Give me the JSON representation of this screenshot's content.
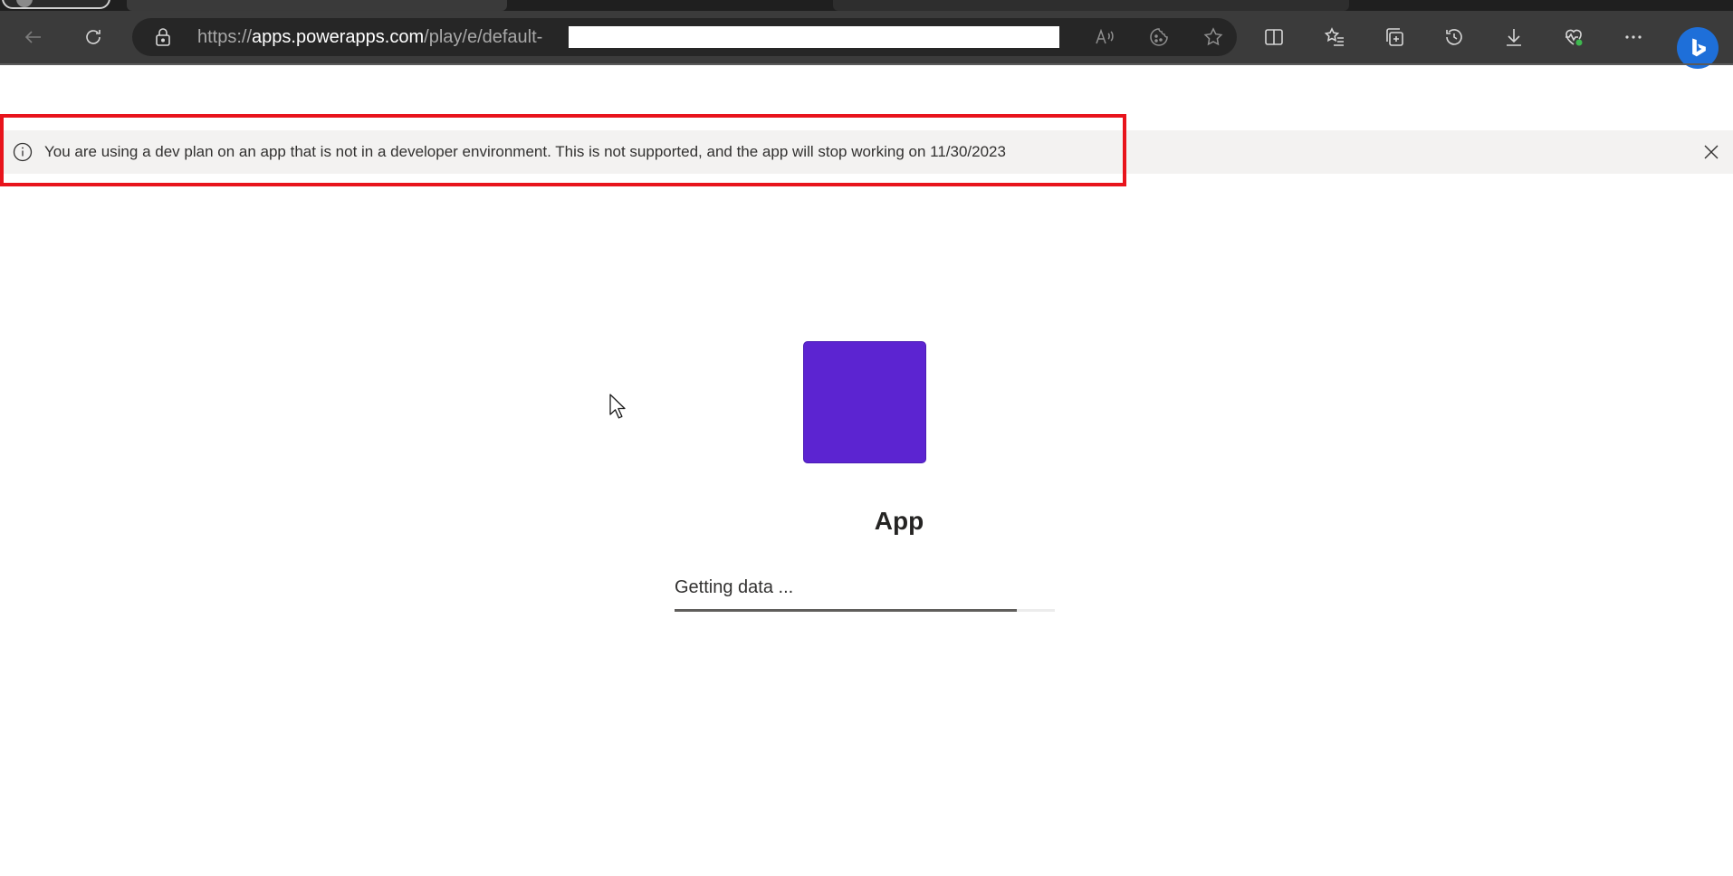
{
  "browser": {
    "url": {
      "scheme": "https://",
      "domain": "apps.powerapps.com",
      "path": "/play/e/default-"
    }
  },
  "banner": {
    "message": "You are using a dev plan on an app that is not in a developer environment. This is not supported, and the app will stop working on 11/30/2023"
  },
  "loading": {
    "app_name": "App",
    "app_tile_color": "#5c24d1",
    "status": "Getting data ...",
    "progress_percent": 90
  },
  "colors": {
    "highlight_border": "#e8141c",
    "banner_bg": "#f3f2f1",
    "toolbar_bg": "#3b3b3b",
    "bing_blue": "#1e6fd9"
  },
  "icons": [
    "back-icon",
    "refresh-icon",
    "lock-icon",
    "read-aloud-icon",
    "cookie-icon",
    "favorite-star-icon",
    "split-screen-icon",
    "favorites-icon",
    "collections-icon",
    "history-icon",
    "downloads-icon",
    "browser-essentials-icon",
    "more-icon",
    "bing-copilot-icon",
    "info-icon",
    "close-icon",
    "mouse-cursor-icon"
  ]
}
